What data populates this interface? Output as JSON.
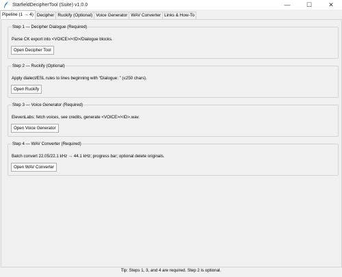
{
  "window": {
    "title": "StarfieldDecipherTool (Suite) v1.0.0",
    "minimize_glyph": "—",
    "maximize_glyph": "☐",
    "close_glyph": "✕"
  },
  "tabs": [
    {
      "label": "Pipeline (1 → 4)",
      "active": true
    },
    {
      "label": "Decipher"
    },
    {
      "label": "Ruckify (Optional)"
    },
    {
      "label": "Voice Generator"
    },
    {
      "label": "WAV Converter"
    },
    {
      "label": "Links & How-To"
    }
  ],
  "steps": [
    {
      "legend": "Step 1 — Decipher Dialogue (Required)",
      "description": "Parse CK export into <VOICE>/<ID>/Dialogue blocks.",
      "button": "Open Decipher Tool"
    },
    {
      "legend": "Step 2 — Ruckify (Optional)",
      "description": "Apply dialect/ESL rules to lines beginning with “Dialogue: ” (≤250 chars).",
      "button": "Open Ruckify"
    },
    {
      "legend": "Step 3 — Voice Generator (Required)",
      "description": "ElevenLabs: fetch voices, see credits, generate <VOICE>/<ID>.wav.",
      "button": "Open Voice Generator"
    },
    {
      "legend": "Step 4 — WAV Converter (Required)",
      "description": "Batch convert 22.05/22.1 kHz → 44.1 kHz; progress bar; optional delete originals.",
      "button": "Open WAV Converter"
    }
  ],
  "footer": {
    "tip": "Tip: Steps 1, 3, and 4 are required. Step 2 is optional."
  }
}
